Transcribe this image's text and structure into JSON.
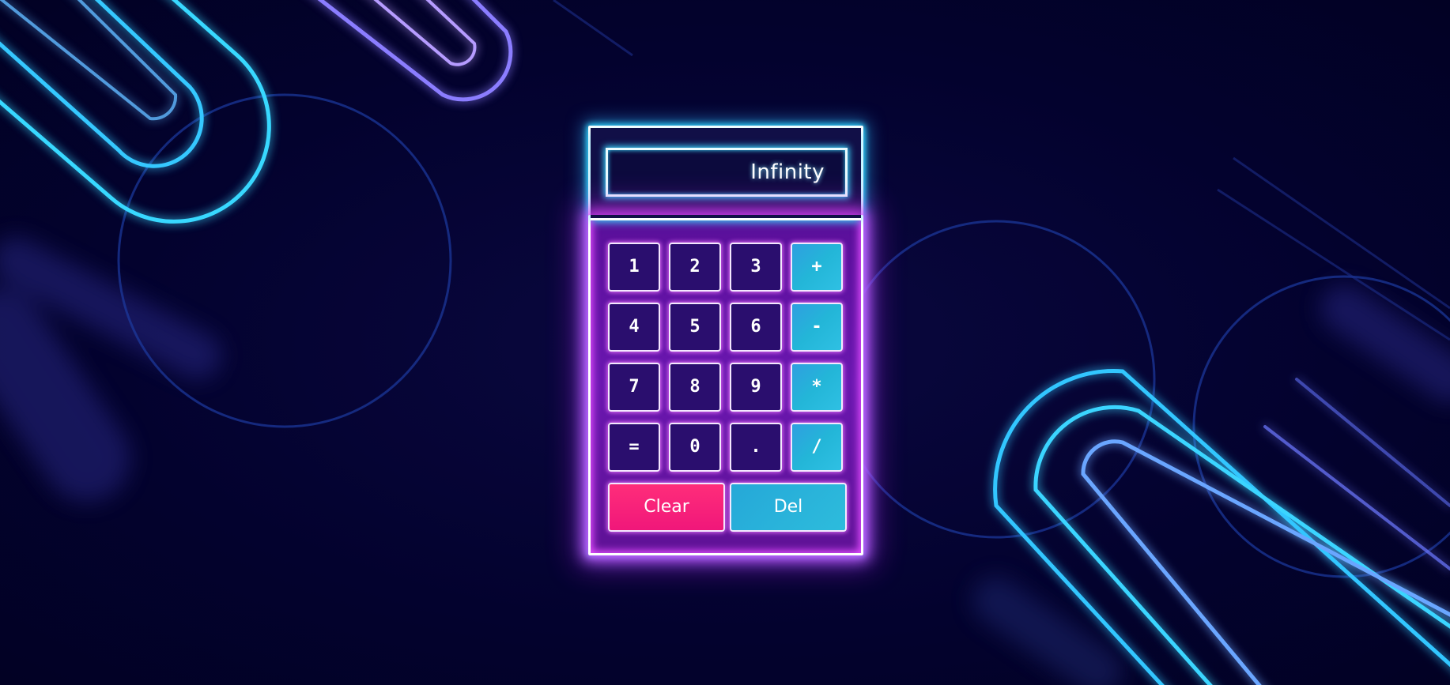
{
  "display": {
    "value": "Infinity"
  },
  "keys": {
    "k1": "1",
    "k2": "2",
    "k3": "3",
    "plus": "+",
    "k4": "4",
    "k5": "5",
    "k6": "6",
    "minus": "-",
    "k7": "7",
    "k8": "8",
    "k9": "9",
    "multiply": "*",
    "equals": "=",
    "k0": "0",
    "dot": ".",
    "divide": "/",
    "clear": "Clear",
    "del": "Del"
  },
  "colors": {
    "background": "#03022e",
    "neon_cyan": "#33d7ff",
    "neon_magenta": "#e24cff",
    "keypad_purple": "#6a17b0",
    "operator_cyan": "#23b6d8",
    "clear_pink": "#ff2d7a"
  }
}
